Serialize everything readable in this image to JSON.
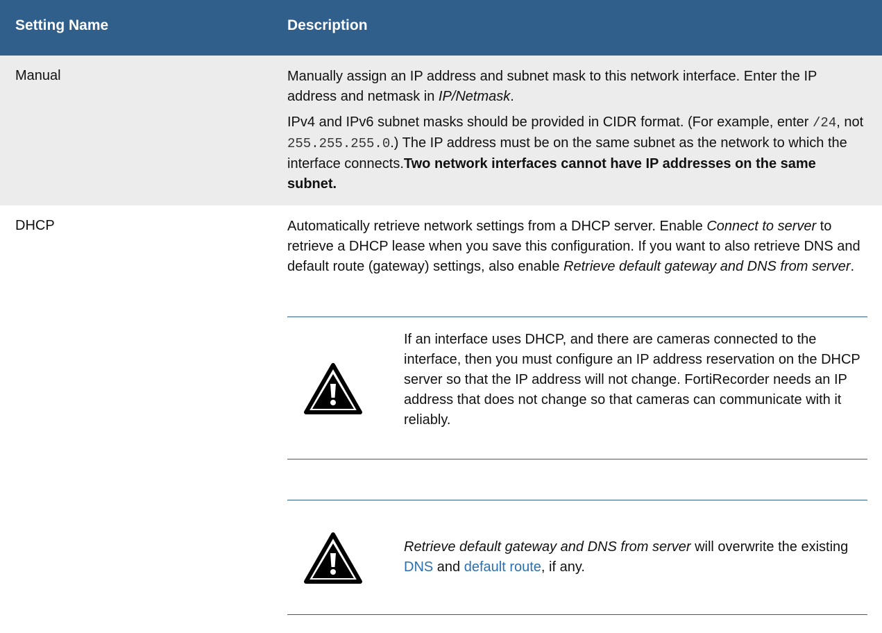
{
  "table": {
    "header": {
      "col1": "Setting Name",
      "col2": "Description"
    },
    "manual": {
      "name": "Manual",
      "p1_text": "Manually assign an IP address and subnet mask to this network interface. Enter the IP address and netmask in ",
      "p1_em": "IP/Netmask",
      "p1_end": ".",
      "p2_a": "IPv4 and IPv6 subnet masks should be provided in CIDR format. (For example, enter ",
      "p2_code1": "/24",
      "p2_b": ", not ",
      "p2_code2": "255.255.255.0",
      "p2_c": ".) The IP address must be on the same subnet as the network to which the interface connects.",
      "p2_bold": "Two network interfaces cannot have IP addresses on the same subnet."
    },
    "dhcp": {
      "name": "DHCP",
      "p1_a": "Automatically retrieve network settings from a DHCP server. Enable ",
      "p1_em1": "Connect to server",
      "p1_b": " to retrieve a DHCP lease when you save this configuration. If you want to also retrieve DNS and default route (gateway) settings, also enable ",
      "p1_em2": "Retrieve default gateway and DNS from server",
      "p1_end": ".",
      "note1": {
        "icon": "warning-triangle-icon",
        "text": "If an interface uses DHCP, and there are cameras connected to the interface, then you must configure an IP address reservation on the DHCP server so that the IP address will not change. FortiRecorder needs an IP address that does not change so that cameras can communicate with it reliably."
      },
      "note2": {
        "icon": "warning-triangle-icon",
        "em": "Retrieve default gateway and DNS from server",
        "text_a": " will overwrite the existing ",
        "link1": "DNS",
        "text_b": " and ",
        "link2": "default route",
        "text_c": ", if any."
      }
    }
  },
  "colors": {
    "header_bg": "#2f5f8a",
    "row_alt_bg": "#ececec",
    "link": "#2a6fb0"
  }
}
